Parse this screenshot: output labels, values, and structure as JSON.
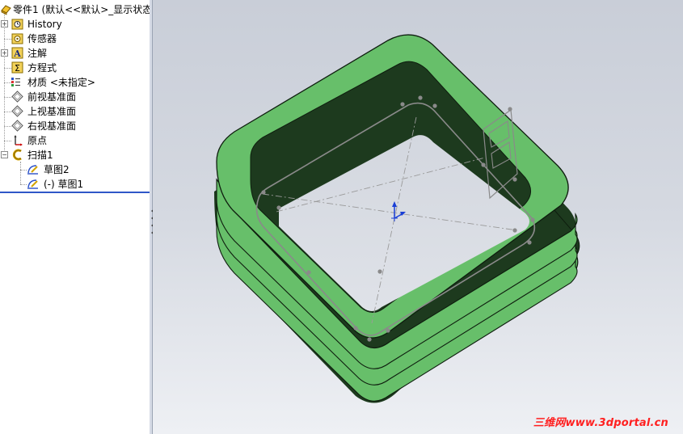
{
  "tree": {
    "root": {
      "label": "零件1 (默认<<默认>_显示状态",
      "icon": "part-icon"
    },
    "items": [
      {
        "label": "History",
        "icon": "history-folder-icon",
        "expander": "+"
      },
      {
        "label": "传感器",
        "icon": "sensor-icon",
        "expander": ""
      },
      {
        "label": "注解",
        "icon": "annotation-icon",
        "expander": "+"
      },
      {
        "label": "方程式",
        "icon": "equation-icon",
        "expander": ""
      },
      {
        "label": "材质 <未指定>",
        "icon": "material-icon",
        "expander": ""
      },
      {
        "label": "前视基准面",
        "icon": "plane-icon",
        "expander": ""
      },
      {
        "label": "上视基准面",
        "icon": "plane-icon",
        "expander": ""
      },
      {
        "label": "右视基准面",
        "icon": "plane-icon",
        "expander": ""
      },
      {
        "label": "原点",
        "icon": "origin-icon",
        "expander": ""
      },
      {
        "label": "扫描1",
        "icon": "sweep-feature-icon",
        "expander": "−"
      },
      {
        "label": "草图2",
        "icon": "sketch-icon",
        "expander": ""
      },
      {
        "label": "(-) 草图1",
        "icon": "sketch-icon",
        "expander": ""
      }
    ]
  },
  "colors": {
    "model_face": "#67bf6a",
    "model_shadow": "#1d3a1e",
    "model_edge": "#0e1d0e",
    "sketch_line": "#8a8a8a",
    "rollback_bar": "#2f57c8",
    "watermark": "#ff2020"
  },
  "watermark": "三维网www.3dportal.cn"
}
